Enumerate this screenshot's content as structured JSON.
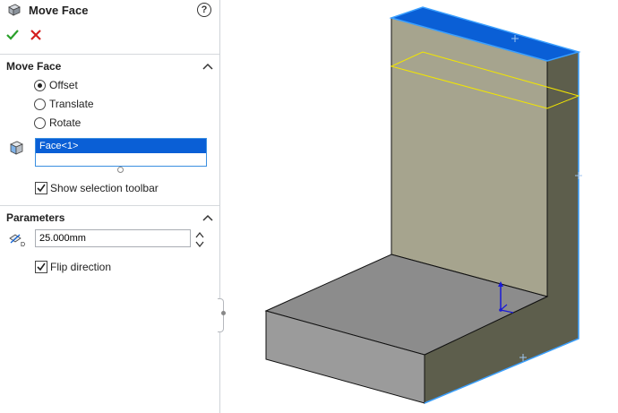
{
  "panel": {
    "title": "Move Face",
    "help_glyph": "?",
    "icons": {
      "title": "move-face-icon",
      "help": "help-icon",
      "ok": "checkmark-icon",
      "cancel": "close-icon"
    }
  },
  "move_face": {
    "section_title": "Move Face",
    "options": [
      {
        "label": "Offset",
        "selected": true
      },
      {
        "label": "Translate",
        "selected": false
      },
      {
        "label": "Rotate",
        "selected": false
      }
    ],
    "selection_item": "Face<1>",
    "show_selection_toolbar_label": "Show selection toolbar",
    "show_selection_toolbar_checked": true
  },
  "parameters": {
    "section_title": "Parameters",
    "distance_value": "25.000mm",
    "flip_direction_label": "Flip direction",
    "flip_direction_checked": true
  },
  "colors": {
    "accent_blue": "#0a5fd6",
    "selected_face": "#0a5fd6",
    "highlight_edge": "#3ba0ff",
    "preview_outline": "#f2e600",
    "vertical_face": "#a6a48e",
    "top_face": "#8c8c8c",
    "side_face": "#5d5e4c",
    "front_face": "#9b9b9b"
  }
}
